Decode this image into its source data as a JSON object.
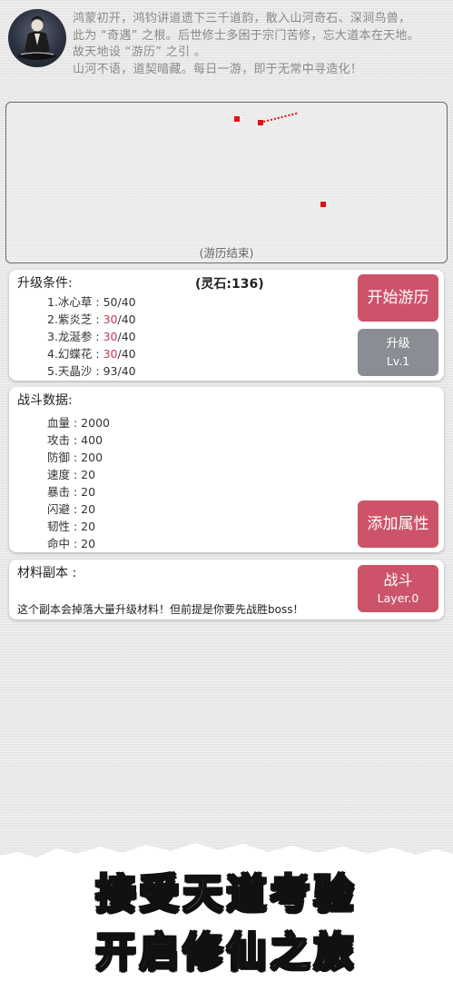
{
  "intro": {
    "lines": [
      "鸿蒙初开，鸿钧讲道遗下三千道韵，散入山河奇石、深涧鸟兽，",
      "此为 “奇遇” 之根。后世修士多困于宗门苦修，忘大道本在天地。",
      "故天地设 “游历” 之引 。",
      "山河不语，道契暗藏。每日一游，即于无常中寻造化！"
    ]
  },
  "map": {
    "status": "(游历结束)"
  },
  "upgrade": {
    "title": "升级条件:",
    "stone": "(灵石:136)",
    "requirements": [
      {
        "label": "1.冰心草 : ",
        "have": "50",
        "need": "/40",
        "short": false
      },
      {
        "label": "2.紫炎芝 : ",
        "have": "30",
        "need": "/40",
        "short": true
      },
      {
        "label": "3.龙涎参 : ",
        "have": "30",
        "need": "/40",
        "short": true
      },
      {
        "label": "4.幻蝶花 : ",
        "have": "30",
        "need": "/40",
        "short": true
      },
      {
        "label": "5.天晶沙 : ",
        "have": "93",
        "need": "/40",
        "short": false
      }
    ],
    "start_button": "开始游历",
    "upgrade_button": "升级",
    "level": "Lv.1"
  },
  "battle": {
    "title": "战斗数据:",
    "stats": [
      "血量 : 2000",
      "攻击 : 400",
      "防御 : 200",
      "速度 : 20",
      "暴击 : 20",
      "闪避 : 20",
      "韧性 : 20",
      "命中 : 20"
    ],
    "add_button": "添加属性"
  },
  "material": {
    "title": "材料副本 :",
    "description": "这个副本会掉落大量升级材料！但前提是你要先战胜boss！",
    "fight_button": "战斗",
    "layer": "Layer.0"
  },
  "slogan": {
    "line1": "接受天道考验",
    "line2": "开启修仙之旅"
  },
  "colors": {
    "accent_pink": "#cd536a",
    "button_gray": "#8a8d93",
    "shortage_red": "#c43a55",
    "map_marker": "#e01010"
  }
}
